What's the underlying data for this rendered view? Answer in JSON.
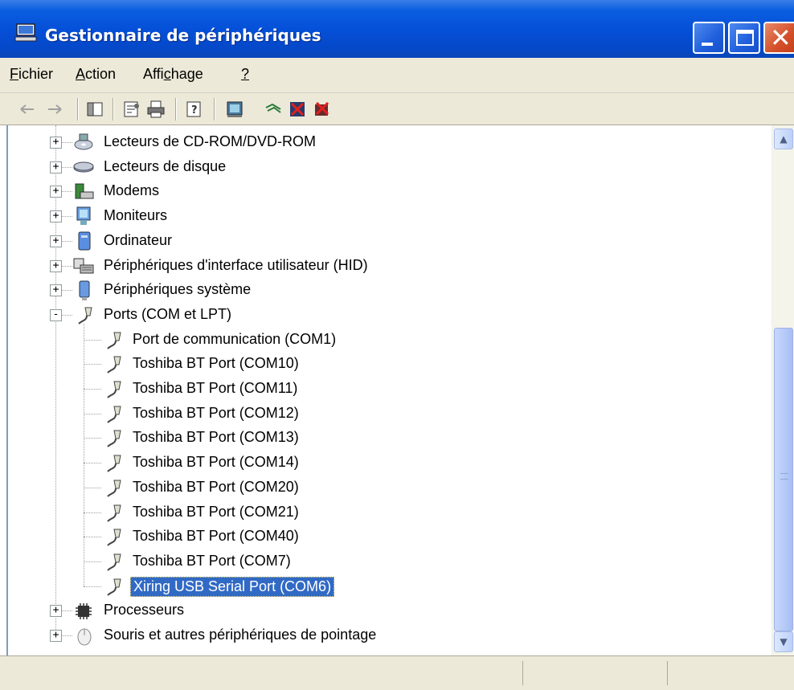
{
  "window": {
    "title": "Gestionnaire de périphériques"
  },
  "menu": [
    {
      "label": "Fichier",
      "accel": "F",
      "rest": "ichier"
    },
    {
      "label": "Action",
      "accel": "A",
      "rest": "ction"
    },
    {
      "label": "Affichage",
      "pre": "Affi",
      "accel": "c",
      "rest": "hage"
    },
    {
      "label": "?",
      "accel": "?",
      "rest": ""
    }
  ],
  "toolbar_icons": [
    "back-arrow-icon",
    "forward-arrow-icon",
    "show-hide-tree-icon",
    "properties-icon",
    "print-icon",
    "help-icon",
    "scan-hardware-icon",
    "update-driver-icon",
    "uninstall-icon",
    "disable-icon"
  ],
  "tree": {
    "categories_top": [
      {
        "label": "Lecteurs de CD-ROM/DVD-ROM",
        "icon": "cdrom-icon"
      },
      {
        "label": "Lecteurs de disque",
        "icon": "disk-drive-icon"
      },
      {
        "label": "Modems",
        "icon": "modem-icon"
      },
      {
        "label": "Moniteurs",
        "icon": "monitor-icon"
      },
      {
        "label": "Ordinateur",
        "icon": "computer-icon"
      },
      {
        "label": "Périphériques d'interface utilisateur (HID)",
        "icon": "hid-icon"
      },
      {
        "label": "Périphériques système",
        "icon": "system-device-icon"
      }
    ],
    "ports_category": {
      "label": "Ports (COM et LPT)",
      "icon": "port-icon",
      "expanded": true
    },
    "ports": [
      {
        "label": "Port de communication (COM1)"
      },
      {
        "label": "Toshiba BT Port (COM10)"
      },
      {
        "label": "Toshiba BT Port (COM11)"
      },
      {
        "label": "Toshiba BT Port (COM12)"
      },
      {
        "label": "Toshiba BT Port (COM13)"
      },
      {
        "label": "Toshiba BT Port (COM14)"
      },
      {
        "label": "Toshiba BT Port (COM20)"
      },
      {
        "label": "Toshiba BT Port (COM21)"
      },
      {
        "label": "Toshiba BT Port (COM40)"
      },
      {
        "label": "Toshiba BT Port (COM7)"
      },
      {
        "label": "Xiring USB Serial Port (COM6)",
        "selected": true
      }
    ],
    "categories_bottom": [
      {
        "label": "Processeurs",
        "icon": "processor-icon"
      },
      {
        "label": "Souris et autres périphériques de pointage",
        "icon": "mouse-icon"
      }
    ]
  },
  "colors": {
    "selection": "#316ac5",
    "titlebar": "#0550d8",
    "chrome": "#ece9d8"
  }
}
